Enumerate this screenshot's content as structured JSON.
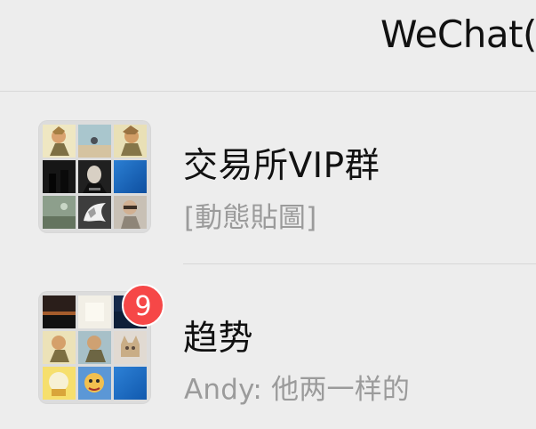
{
  "header": {
    "title": "WeChat("
  },
  "chats": [
    {
      "name": "交易所VIP群",
      "preview": "[動態貼圖]",
      "avatar_tiles": [
        "anime-character-avatar",
        "beach-avatar",
        "anime-character-avatar",
        "dark-avatar",
        "portrait-avatar",
        "blue-gradient-avatar",
        "landscape-avatar",
        "dragon-avatar",
        "portrait-avatar"
      ]
    },
    {
      "name": "趋势",
      "preview": "Andy: 他两一样的",
      "unread_count": "9",
      "avatar_tiles": [
        "dark-sunset-avatar",
        "paper-avatar",
        "blue-avatar",
        "anime-character-avatar",
        "anime-character-avatar",
        "cat-avatar",
        "yellow-cartoon-avatar",
        "cartoon-avatar",
        "blue-gradient-avatar"
      ]
    }
  ],
  "colors": {
    "background": "#ededed",
    "badge": "#f64747",
    "name_text": "#111111",
    "preview_text": "#9b9b9b",
    "divider": "#d7d7d7"
  }
}
